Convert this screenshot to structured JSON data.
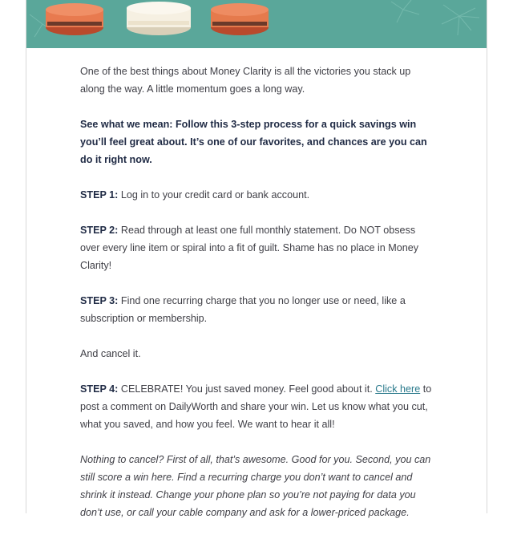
{
  "colors": {
    "hero_bg": "#5aa79a",
    "text": "#3f3f46",
    "heading_text": "#1f2a44",
    "link": "#2a7a8c"
  },
  "intro": "One of the best things about Money Clarity is all the victories you stack up along the way. A little momentum goes a long way.",
  "lead": "See what we mean: Follow this 3-step process for a quick savings win you’ll feel great about. It’s one of our favorites, and chances are you can do it right now.",
  "steps": [
    {
      "label": "STEP 1:",
      "text": " Log in to your credit card or bank account."
    },
    {
      "label": "STEP 2:",
      "text": " Read through at least one full monthly statement. Do NOT obsess over every line item or spiral into a fit of guilt. Shame has no place in Money Clarity!"
    },
    {
      "label": "STEP 3:",
      "text": " Find one recurring charge that you no longer use or need, like a subscription or membership."
    }
  ],
  "cancel_line": "And cancel it.",
  "step4": {
    "label": "STEP 4:",
    "text_before": " CELEBRATE! You just saved money. Feel good about it. ",
    "link_text": "Click here",
    "text_after": " to post a comment on DailyWorth and share your win. Let us know what you cut, what you saved, and how you feel. We want to hear it all!"
  },
  "footnote": "Nothing to cancel? First of all, that’s awesome. Good for you. Second, you can still score a win here. Find a recurring charge you don’t want to cancel and shrink it instead. Change your phone plan so you’re not paying for data you don’t use, or call your cable company and ask for a lower-priced package."
}
